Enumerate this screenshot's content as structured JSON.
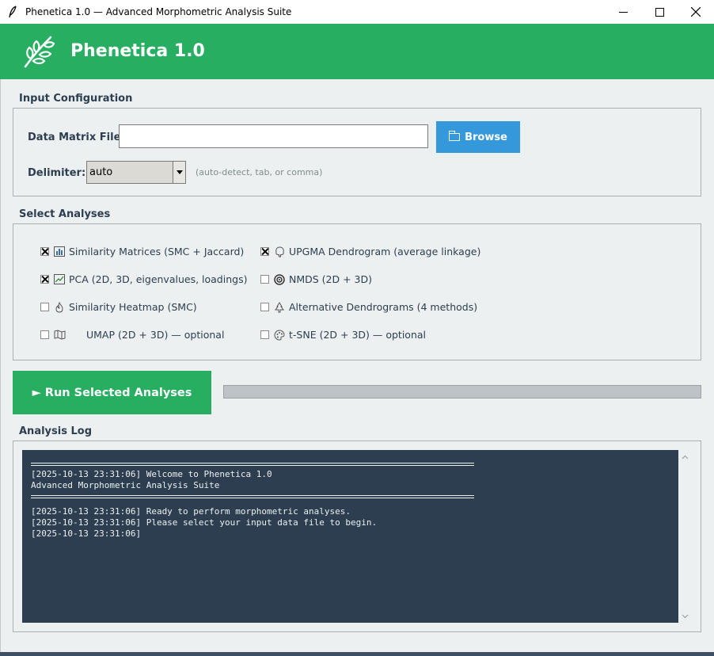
{
  "window": {
    "title": "Phenetica 1.0 — Advanced Morphometric Analysis Suite",
    "app_icon": "feather-icon",
    "minimize": "minimize-icon",
    "maximize": "maximize-icon",
    "close": "close-icon"
  },
  "header": {
    "app_name": "Phenetica 1.0",
    "logo": "leaf-branch-icon",
    "color": "#27ae60"
  },
  "input_config": {
    "title": "Input Configuration",
    "file_label": "Data Matrix File:",
    "file_value": "",
    "browse_label": "Browse",
    "browse_icon": "folder-icon",
    "delimiter_label": "Delimiter:",
    "delimiter_value": "auto",
    "delimiter_hint": "(auto-detect, tab, or comma)"
  },
  "analyses": {
    "title": "Select Analyses",
    "items": [
      {
        "label": "Similarity Matrices (SMC + Jaccard)",
        "checked": true,
        "icon": "bar-chart-icon"
      },
      {
        "label": "UPGMA Dendrogram (average linkage)",
        "checked": true,
        "icon": "tree-icon"
      },
      {
        "label": "PCA (2D, 3D, eigenvalues, loadings)",
        "checked": true,
        "icon": "line-chart-icon"
      },
      {
        "label": "NMDS (2D + 3D)",
        "checked": false,
        "icon": "target-icon"
      },
      {
        "label": "Similarity Heatmap (SMC)",
        "checked": false,
        "icon": "fire-icon"
      },
      {
        "label": "Alternative Dendrograms (4 methods)",
        "checked": false,
        "icon": "conifer-icon"
      },
      {
        "label": "UMAP (2D + 3D) — optional",
        "checked": false,
        "icon": "map-icon"
      },
      {
        "label": "t-SNE (2D + 3D) — optional",
        "checked": false,
        "icon": "palette-icon"
      }
    ]
  },
  "run": {
    "label": "► Run Selected Analyses",
    "progress": 0,
    "color": "#27ae60"
  },
  "log": {
    "title": "Analysis Log",
    "lines_a": [
      "[2025-10-13 23:31:06] Welcome to Phenetica 1.0",
      "Advanced Morphometric Analysis Suite"
    ],
    "lines_b": [
      "[2025-10-13 23:31:06] Ready to perform morphometric analyses.",
      "[2025-10-13 23:31:06] Please select your input data file to begin.",
      "[2025-10-13 23:31:06]"
    ],
    "background": "#2c3e50"
  }
}
